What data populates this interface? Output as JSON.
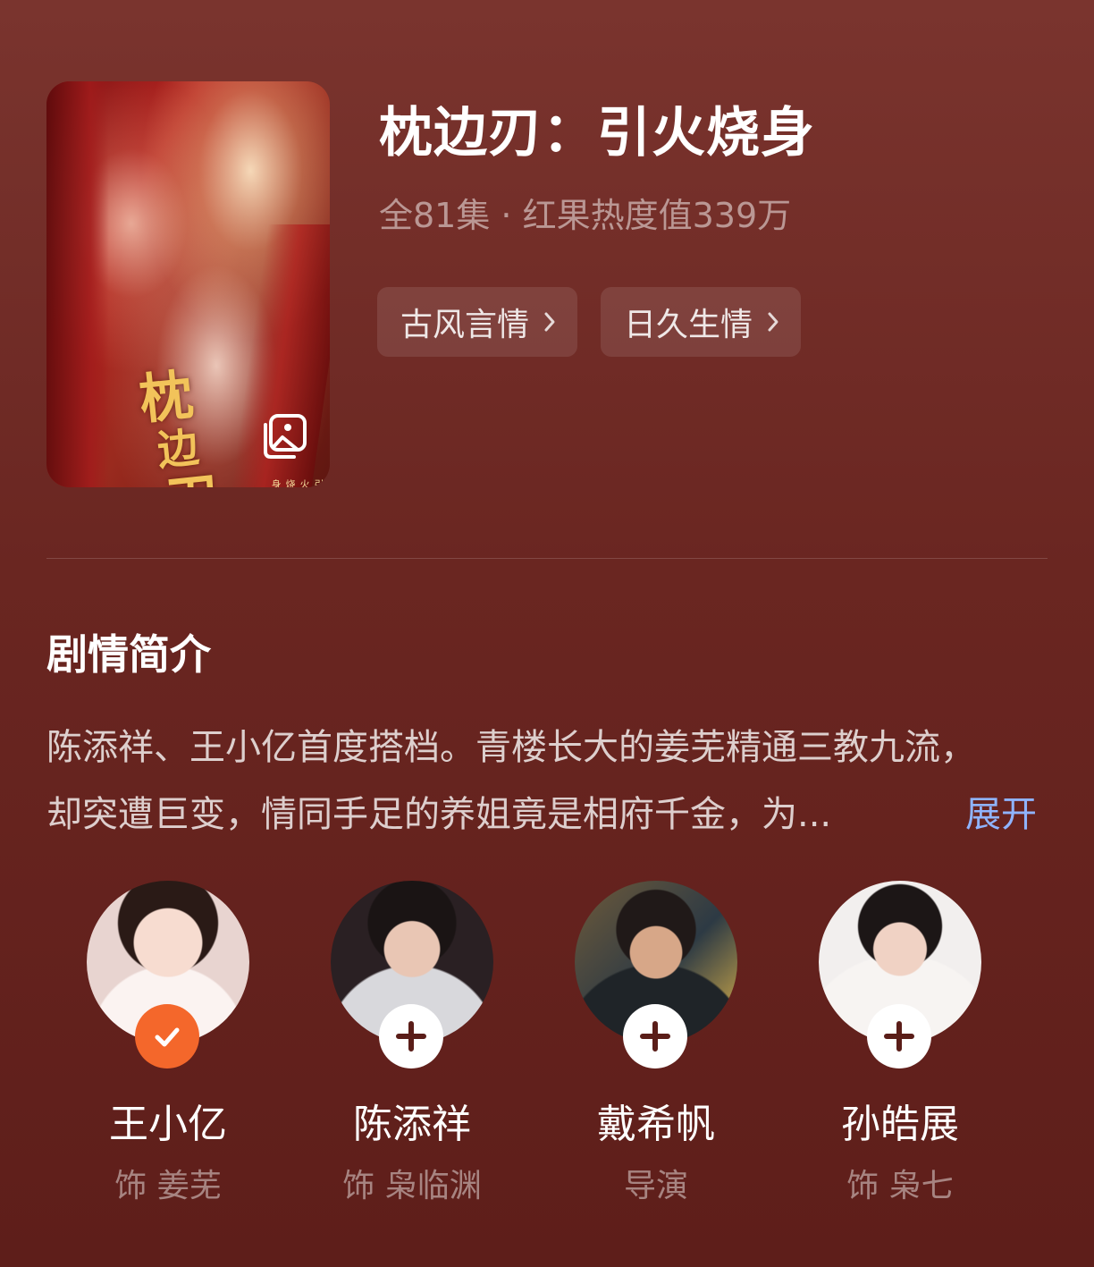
{
  "show": {
    "title": "枕边刃：引火烧身",
    "meta": "全81集 · 红果热度值339万",
    "poster_logo": [
      "枕",
      "边",
      "刃"
    ],
    "poster_sub": "引火烧身",
    "tags": [
      {
        "label": "古风言情"
      },
      {
        "label": "日久生情"
      }
    ]
  },
  "synopsis": {
    "heading": "剧情简介",
    "line1": "陈添祥、王小亿首度搭档。青楼长大的姜芜精通三教九流，",
    "line2": "却突遭巨变，情同手足的养姐竟是相府千金，为...",
    "expand_label": "展开"
  },
  "cast": [
    {
      "name": "王小亿",
      "role": "饰 姜芜",
      "followed": true
    },
    {
      "name": "陈添祥",
      "role": "饰 枭临渊",
      "followed": false
    },
    {
      "name": "戴希帆",
      "role": "导演",
      "followed": false
    },
    {
      "name": "孙皓展",
      "role": "饰 枭七",
      "followed": false
    }
  ],
  "colors": {
    "accent_follow": "#f4672b",
    "expand_link": "#8fb4ff"
  }
}
